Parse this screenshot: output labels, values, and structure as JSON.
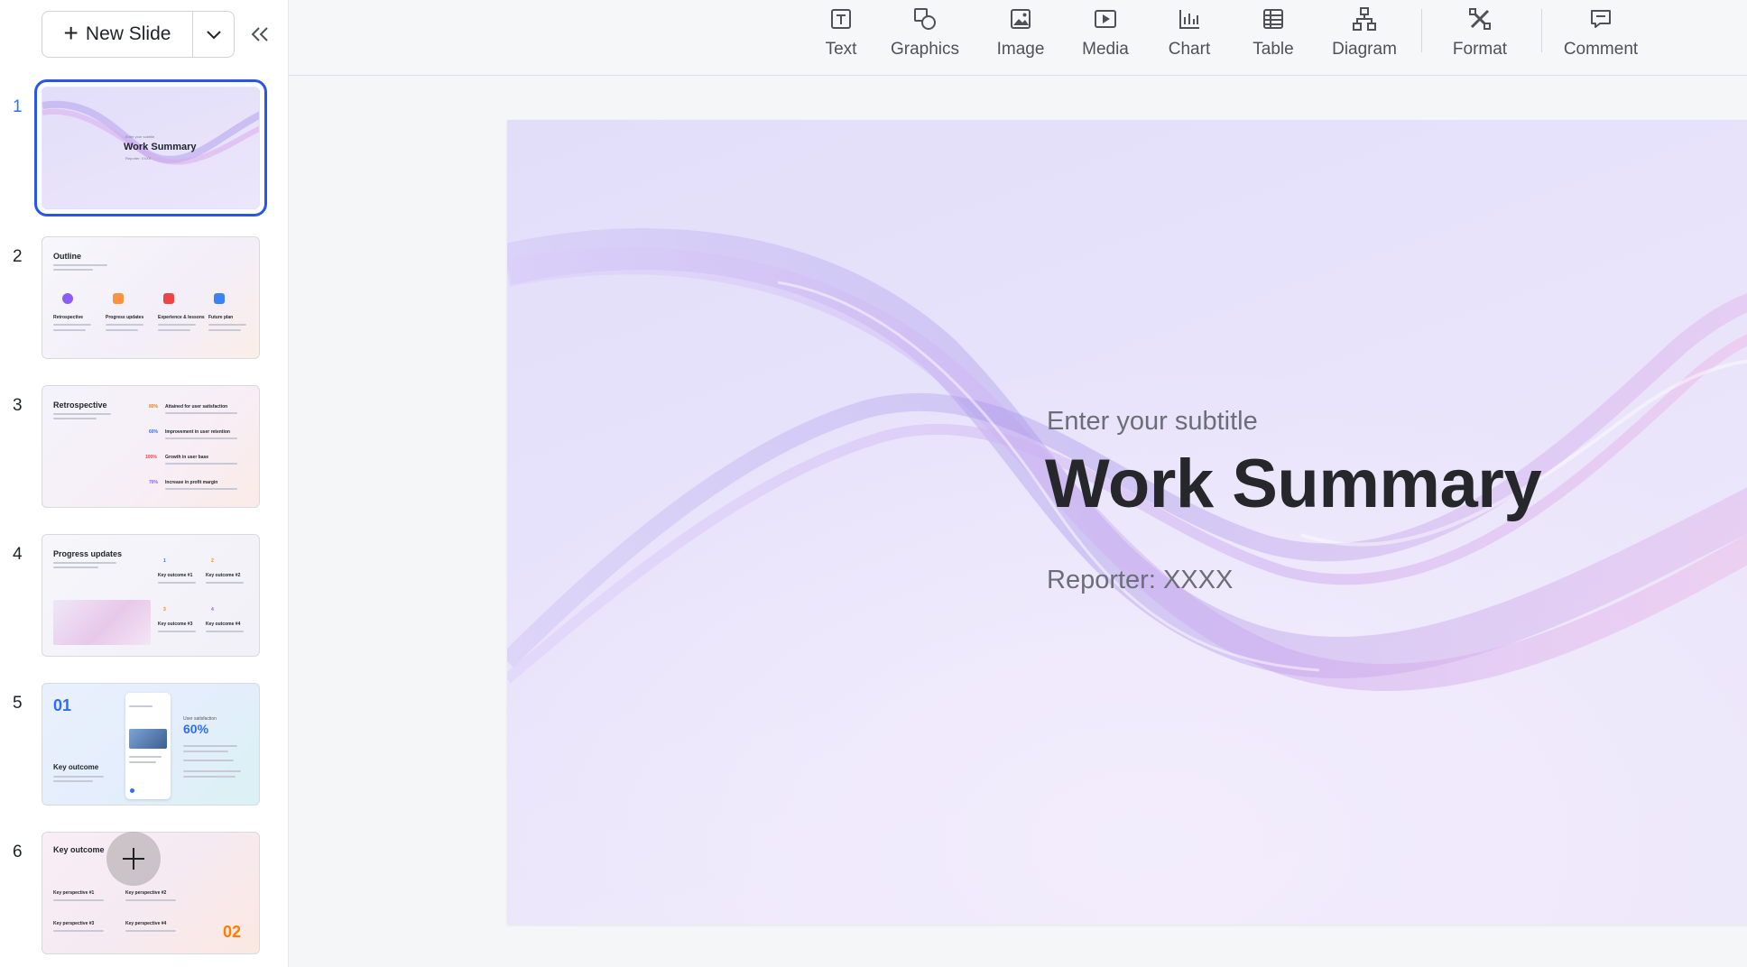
{
  "sidebar": {
    "new_slide_label": "New Slide",
    "slides": [
      {
        "number": "1",
        "subtitle": "Enter your subtitle",
        "title": "Work Summary",
        "reporter": "Reporter: XXXX"
      },
      {
        "number": "2",
        "title": "Outline",
        "items": [
          "Retrospective",
          "Progress updates",
          "Experience & lessons",
          "Future plan"
        ]
      },
      {
        "number": "3",
        "title": "Retrospective",
        "stats": [
          {
            "value": "80%",
            "label": "Attained for user satisfaction"
          },
          {
            "value": "60%",
            "label": "Improvement in user retention"
          },
          {
            "value": "100%",
            "label": "Growth in user base"
          },
          {
            "value": "70%",
            "label": "Increase in profit margin"
          }
        ]
      },
      {
        "number": "4",
        "title": "Progress updates",
        "outcomes": [
          {
            "num": "1",
            "label": "Key outcome #1"
          },
          {
            "num": "2",
            "label": "Key outcome #2"
          },
          {
            "num": "3",
            "label": "Key outcome #3"
          },
          {
            "num": "4",
            "label": "Key outcome #4"
          }
        ]
      },
      {
        "number": "5",
        "index": "01",
        "title": "Key outcome",
        "stat_caption": "User satisfaction",
        "stat_value": "60%"
      },
      {
        "number": "6",
        "title": "Key outcome",
        "perspectives": [
          "Key perspective #1",
          "Key perspective #2",
          "Key perspective #3",
          "Key perspective #4"
        ],
        "index": "02"
      }
    ]
  },
  "toolbar": {
    "tools": [
      {
        "label": "Text",
        "icon": "text-icon"
      },
      {
        "label": "Graphics",
        "icon": "graphics-icon"
      },
      {
        "label": "Image",
        "icon": "image-icon"
      },
      {
        "label": "Media",
        "icon": "media-icon"
      },
      {
        "label": "Chart",
        "icon": "chart-icon"
      },
      {
        "label": "Table",
        "icon": "table-icon"
      },
      {
        "label": "Diagram",
        "icon": "diagram-icon"
      },
      {
        "label": "Format",
        "icon": "format-icon"
      },
      {
        "label": "Comment",
        "icon": "comment-icon"
      }
    ]
  },
  "slide": {
    "subtitle": "Enter your subtitle",
    "title": "Work Summary",
    "reporter": "Reporter: XXXX"
  },
  "colors": {
    "accent": "#3370ff",
    "orange": "#ff7d00",
    "blue": "#2f6bff"
  }
}
